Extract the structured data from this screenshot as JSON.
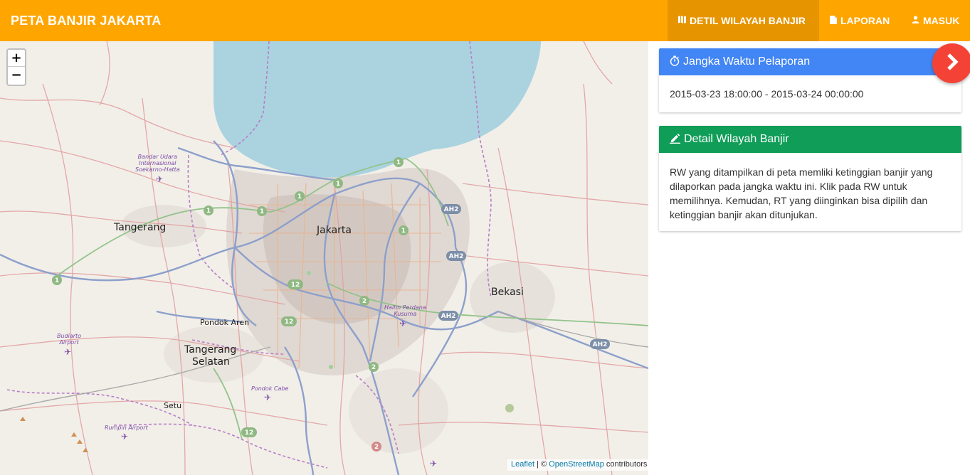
{
  "navbar": {
    "brand": "PETA BANJIR JAKARTA",
    "items": [
      {
        "label": "DETIL WILAYAH BANJIR",
        "icon": "map-icon",
        "active": true
      },
      {
        "label": "LAPORAN",
        "icon": "document-icon",
        "active": false
      },
      {
        "label": "MASUK",
        "icon": "user-icon",
        "active": false
      }
    ],
    "color": "#ffa500"
  },
  "map": {
    "zoom_in": "+",
    "zoom_out": "−",
    "labels": {
      "jakarta": "Jakarta",
      "tangerang": "Tangerang",
      "bekasi": "Bekasi",
      "pondok_aren": "Pondok Aren",
      "tangerang_selatan_1": "Tangerang",
      "tangerang_selatan_2": "Selatan",
      "setu": "Setu",
      "airport_1": "Bandar Udara",
      "airport_2": "Internasional",
      "airport_3": "Soekarno-Hatta",
      "halim_1": "Halim Perdana",
      "halim_2": "Kusuma",
      "budiarto_1": "Budiarto",
      "budiarto_2": "Airport",
      "pondok_cabe": "Pondok Cabe",
      "rumpin": "Rumpin Airport"
    },
    "attribution": {
      "leaflet": "Leaflet",
      "separator": " | © ",
      "osm": "OpenStreetMap",
      "suffix": " contributors"
    }
  },
  "panels": {
    "time": {
      "title": "Jangka Waktu Pelaporan",
      "icon": "stopwatch-icon",
      "value": "2015-03-23 18:00:00 - 2015-03-24 00:00:00",
      "color": "#4285f4"
    },
    "detail": {
      "title": "Detail Wilayah Banjir",
      "icon": "pencil-icon",
      "text": "RW yang ditampilkan di peta memliki ketinggian banjir yang dilaporkan pada jangka waktu ini. Klik pada RW untuk memilihnya. Kemudan, RT yang diinginkan bisa dipilih dan ketinggian banjir akan ditunjukan.",
      "color": "#0f9d58"
    }
  },
  "fab": {
    "icon": "chevron-right-icon",
    "color": "#f44336"
  }
}
